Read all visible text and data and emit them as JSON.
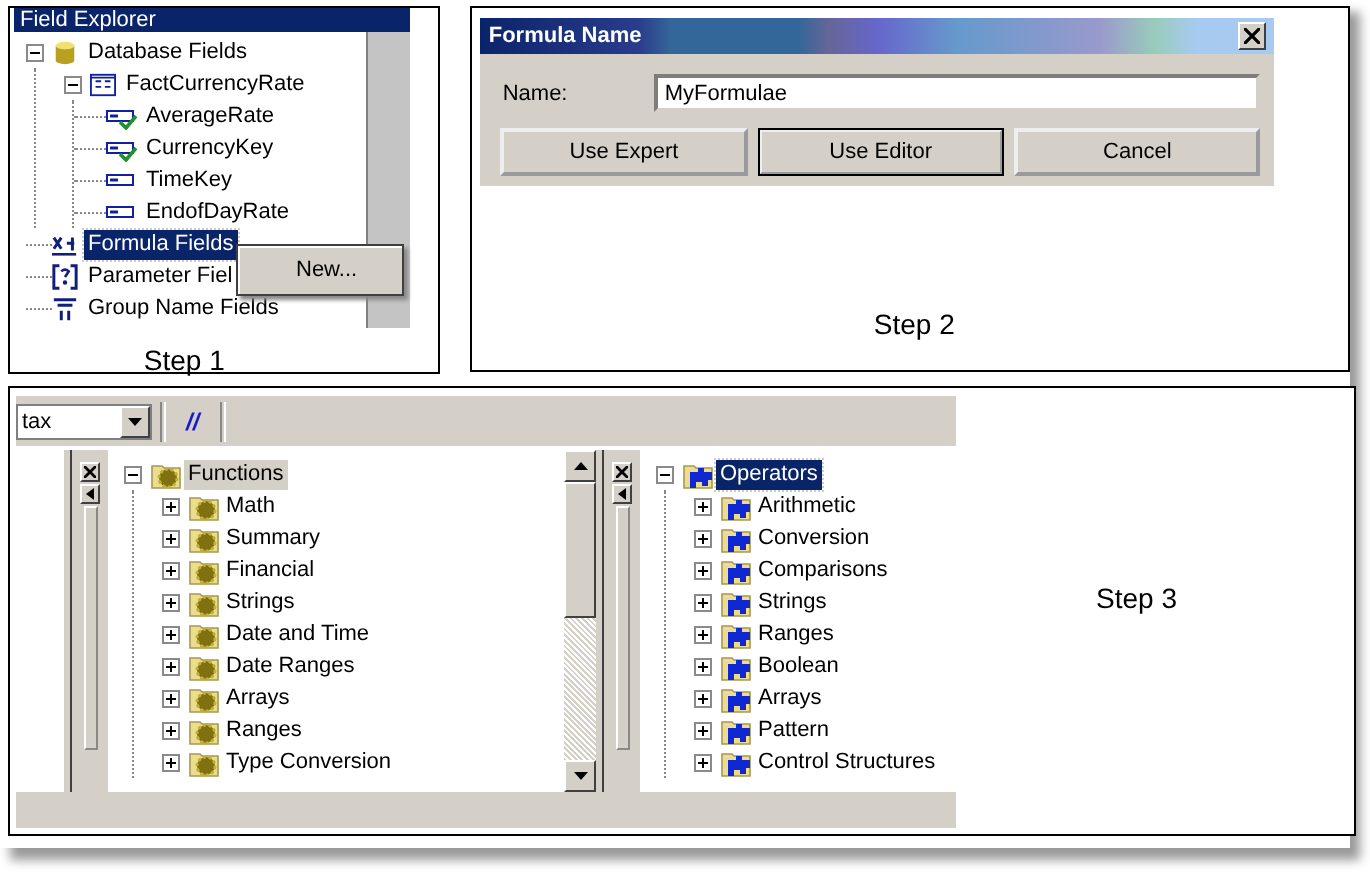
{
  "step1": {
    "caption": "Step 1",
    "panel_title": "Field Explorer",
    "tree": [
      {
        "label": "Database Fields",
        "kind": "database",
        "expanded": true,
        "selected": false,
        "children": [
          {
            "label": "FactCurrencyRate",
            "kind": "table",
            "expanded": true,
            "selected": false,
            "children": [
              {
                "label": "AverageRate",
                "kind": "field",
                "used": true,
                "selected": false
              },
              {
                "label": "CurrencyKey",
                "kind": "field",
                "used": true,
                "selected": false
              },
              {
                "label": "TimeKey",
                "kind": "field",
                "used": false,
                "selected": false
              },
              {
                "label": "EndofDayRate",
                "kind": "field",
                "used": false,
                "selected": false
              }
            ]
          }
        ]
      },
      {
        "label": "Formula Fields",
        "kind": "formula",
        "selected": true
      },
      {
        "label": "Parameter Fiel",
        "kind": "parameter",
        "selected": false
      },
      {
        "label": "Group Name Fields",
        "kind": "group",
        "selected": false
      }
    ],
    "context_menu": {
      "items": [
        {
          "label": "New..."
        }
      ]
    }
  },
  "step2": {
    "caption": "Step 2",
    "dialog_title": "Formula Name",
    "name_label": "Name:",
    "name_value": "MyFormulae",
    "buttons": [
      {
        "label": "Use Expert",
        "default": false
      },
      {
        "label": "Use Editor",
        "default": true
      },
      {
        "label": "Cancel",
        "default": false
      }
    ]
  },
  "step3": {
    "caption": "Step 3",
    "combo_value": "tax",
    "toolbar_button": "//",
    "trees": [
      {
        "kind": "gear",
        "focused": false,
        "scrollbar": true,
        "root": {
          "label": "Functions",
          "expanded": true,
          "selected": true
        },
        "children": [
          {
            "label": "Math",
            "expanded": false,
            "selected": false
          },
          {
            "label": "Summary",
            "expanded": false,
            "selected": false
          },
          {
            "label": "Financial",
            "expanded": false,
            "selected": false
          },
          {
            "label": "Strings",
            "expanded": false,
            "selected": false
          },
          {
            "label": "Date and Time",
            "expanded": false,
            "selected": false
          },
          {
            "label": "Date Ranges",
            "expanded": false,
            "selected": false
          },
          {
            "label": "Arrays",
            "expanded": false,
            "selected": false
          },
          {
            "label": "Ranges",
            "expanded": false,
            "selected": false
          },
          {
            "label": "Type Conversion",
            "expanded": false,
            "selected": false
          }
        ]
      },
      {
        "kind": "puzzle",
        "focused": true,
        "scrollbar": false,
        "root": {
          "label": "Operators",
          "expanded": true,
          "selected": true
        },
        "children": [
          {
            "label": "Arithmetic",
            "expanded": false,
            "selected": false
          },
          {
            "label": "Conversion",
            "expanded": false,
            "selected": false
          },
          {
            "label": "Comparisons",
            "expanded": false,
            "selected": false
          },
          {
            "label": "Strings",
            "expanded": false,
            "selected": false
          },
          {
            "label": "Ranges",
            "expanded": false,
            "selected": false
          },
          {
            "label": "Boolean",
            "expanded": false,
            "selected": false
          },
          {
            "label": "Arrays",
            "expanded": false,
            "selected": false
          },
          {
            "label": "Pattern",
            "expanded": false,
            "selected": false
          },
          {
            "label": "Control Structures",
            "expanded": false,
            "selected": false
          }
        ]
      }
    ]
  }
}
